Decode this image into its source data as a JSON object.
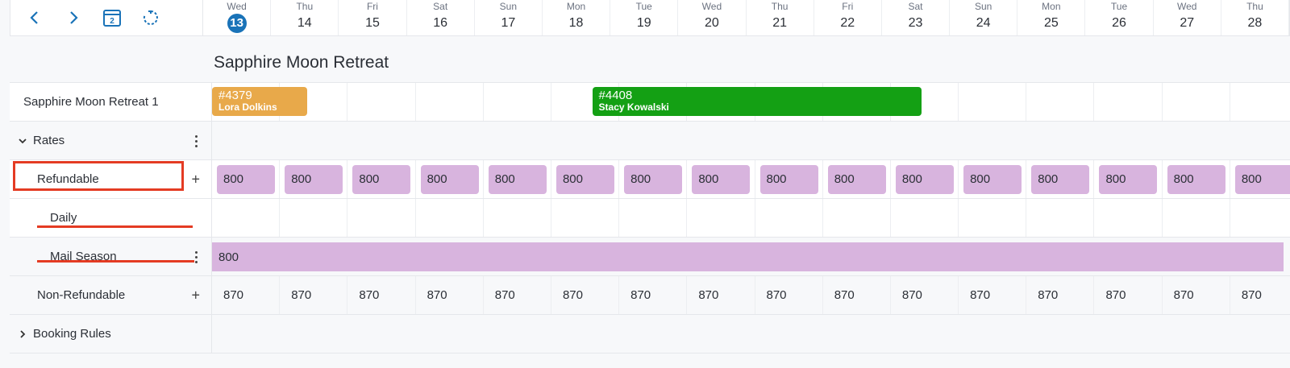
{
  "header": {
    "nav": [
      {
        "name": "prev-icon"
      },
      {
        "name": "next-icon"
      },
      {
        "name": "calendar-icon",
        "badge": "2"
      },
      {
        "name": "refresh-icon"
      }
    ],
    "days": [
      {
        "wd": "Wed",
        "dn": "13",
        "today": true
      },
      {
        "wd": "Thu",
        "dn": "14"
      },
      {
        "wd": "Fri",
        "dn": "15"
      },
      {
        "wd": "Sat",
        "dn": "16"
      },
      {
        "wd": "Sun",
        "dn": "17"
      },
      {
        "wd": "Mon",
        "dn": "18"
      },
      {
        "wd": "Tue",
        "dn": "19"
      },
      {
        "wd": "Wed",
        "dn": "20"
      },
      {
        "wd": "Thu",
        "dn": "21"
      },
      {
        "wd": "Fri",
        "dn": "22"
      },
      {
        "wd": "Sat",
        "dn": "23"
      },
      {
        "wd": "Sun",
        "dn": "24"
      },
      {
        "wd": "Mon",
        "dn": "25"
      },
      {
        "wd": "Tue",
        "dn": "26"
      },
      {
        "wd": "Wed",
        "dn": "27"
      },
      {
        "wd": "Thu",
        "dn": "28"
      }
    ]
  },
  "property": {
    "title": "Sapphire Moon Retreat",
    "unit": "Sapphire Moon Retreat 1",
    "bookings": [
      {
        "id": "#4379",
        "guest": "Lora Dolkins",
        "color": "#e8a94a",
        "start_day": 0,
        "nights": 1.4
      },
      {
        "id": "#4408",
        "guest": "Stacy Kowalski",
        "color": "#14a014",
        "start_day": 5.6,
        "nights": 4.85
      }
    ]
  },
  "rates": {
    "label": "Rates",
    "refundable": {
      "label": "Refundable",
      "values": [
        "800",
        "800",
        "800",
        "800",
        "800",
        "800",
        "800",
        "800",
        "800",
        "800",
        "800",
        "800",
        "800",
        "800",
        "800",
        "800"
      ]
    },
    "daily": {
      "label": "Daily"
    },
    "mail_season": {
      "label": "Mail Season",
      "value": "800"
    },
    "non_refundable": {
      "label": "Non-Refundable",
      "values": [
        "870",
        "870",
        "870",
        "870",
        "870",
        "870",
        "870",
        "870",
        "870",
        "870",
        "870",
        "870",
        "870",
        "870",
        "870",
        "870"
      ]
    }
  },
  "booking_rules": {
    "label": "Booking Rules"
  },
  "colors": {
    "accent": "#1a73b8",
    "rate_chip": "#d8b4de",
    "highlight": "#e43b23"
  }
}
